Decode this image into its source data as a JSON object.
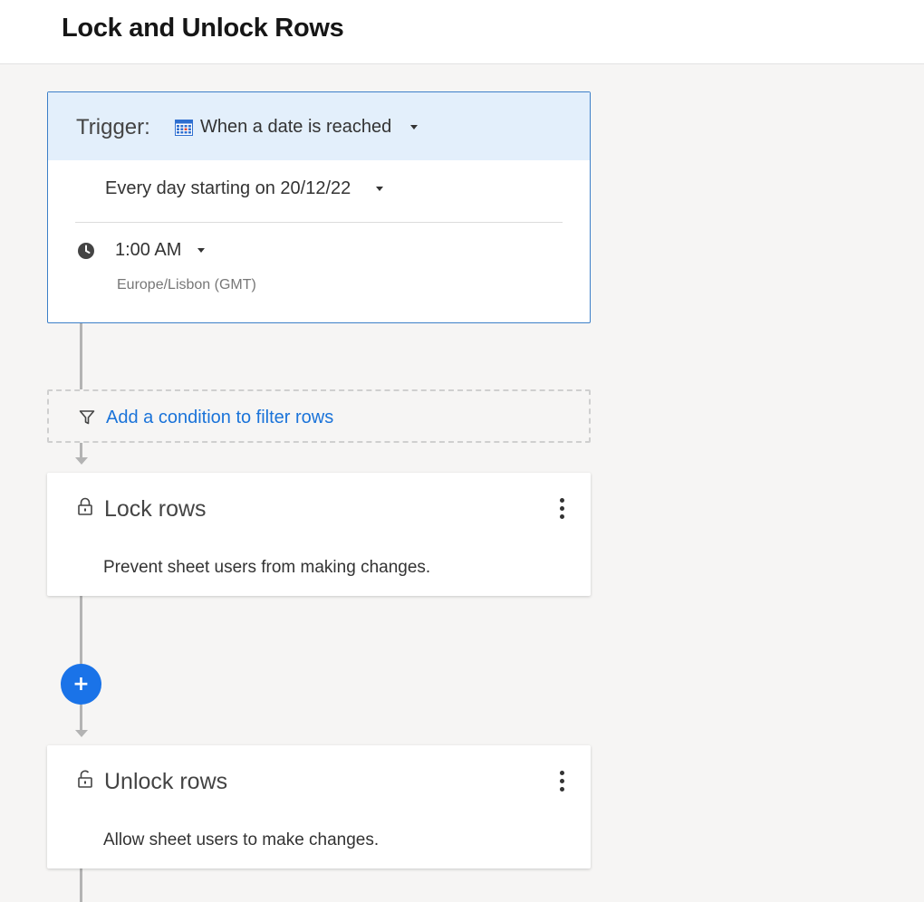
{
  "header": {
    "title": "Lock and Unlock Rows"
  },
  "trigger": {
    "label": "Trigger:",
    "icon": "calendar-icon",
    "type": "When a date is reached",
    "schedule": "Every day starting on 20/12/22",
    "time": "1:00 AM",
    "timezone": "Europe/Lisbon (GMT)",
    "accent_color": "#3c7fc8",
    "header_bg": "#e3effb"
  },
  "condition": {
    "icon": "filter-icon",
    "link_text": "Add a condition to filter rows",
    "link_color": "#1a73d9"
  },
  "actions": [
    {
      "icon": "lock-icon",
      "title": "Lock rows",
      "description": "Prevent sheet users from making changes."
    },
    {
      "icon": "unlock-icon",
      "title": "Unlock rows",
      "description": "Allow sheet users to make changes."
    }
  ],
  "add_button": {
    "label": "+",
    "color": "#1a73e8"
  }
}
